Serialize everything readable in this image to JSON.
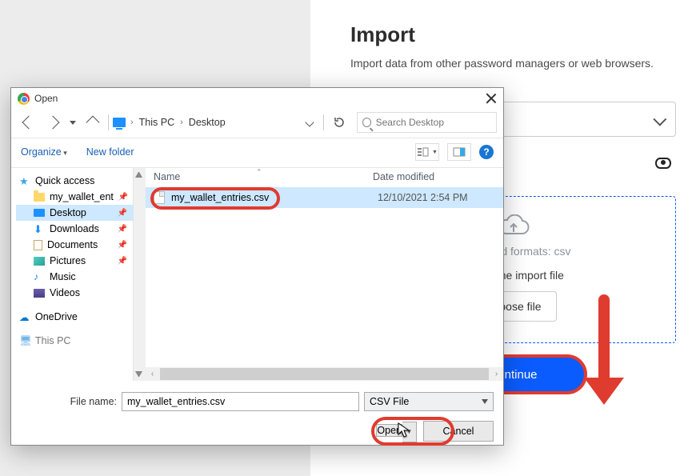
{
  "colors": {
    "accent_blue": "#0b5cff",
    "highlight_red": "#e03b2f",
    "selection_blue": "#cde8ff"
  },
  "import_page": {
    "title": "Import",
    "subtitle": "Import data from other password managers or web browsers.",
    "dropzone": {
      "formats_text": "Supported formats: csv",
      "label_text": "Select the import file",
      "choose_button": "Choose file"
    },
    "continue_button": "Continue"
  },
  "file_dialog": {
    "title": "Open",
    "breadcrumb": {
      "seg1": "This PC",
      "seg2": "Desktop"
    },
    "search_placeholder": "Search Desktop",
    "toolbar": {
      "organize": "Organize",
      "new_folder": "New folder",
      "help_glyph": "?"
    },
    "columns": {
      "name": "Name",
      "date_modified": "Date modified"
    },
    "sidebar": {
      "quick_access": "Quick access",
      "items": [
        {
          "label": "my_wallet_ent",
          "icon": "folder"
        },
        {
          "label": "Desktop",
          "icon": "desktop",
          "selected": true
        },
        {
          "label": "Downloads",
          "icon": "downloads"
        },
        {
          "label": "Documents",
          "icon": "docs"
        },
        {
          "label": "Pictures",
          "icon": "pics"
        },
        {
          "label": "Music",
          "icon": "music"
        },
        {
          "label": "Videos",
          "icon": "videos"
        }
      ],
      "onedrive": "OneDrive",
      "this_pc": "This PC"
    },
    "files": [
      {
        "name": "my_wallet_entries.csv",
        "date": "12/10/2021 2:54 PM",
        "selected": true
      }
    ],
    "footer": {
      "file_name_label": "File name:",
      "file_name_value": "my_wallet_entries.csv",
      "type_filter": "CSV File",
      "open_button": "Open",
      "cancel_button": "Cancel"
    }
  }
}
